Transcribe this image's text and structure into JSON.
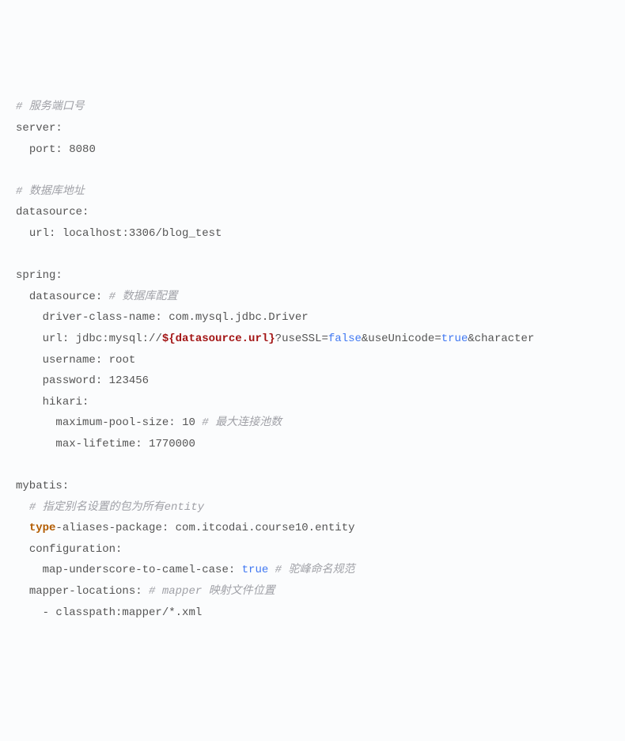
{
  "c_port": "# 服务端口号",
  "server": "server:",
  "port_k": "port:",
  "port_v": "8080",
  "c_db": "# 数据库地址",
  "ds": "datasource:",
  "ds_url_k": "url:",
  "ds_url_v": "localhost:3306/blog_test",
  "spring": "spring:",
  "spring_ds": "datasource:",
  "c_dbconf": "# 数据库配置",
  "driver_k": "driver-class-name:",
  "driver_v": "com.mysql.jdbc.Driver",
  "surl_k": "url:",
  "surl_pre": "jdbc:mysql://",
  "surl_ph": "${datasource.url}",
  "surl_q": "?useSSL=",
  "false": "false",
  "amp_uni": "&useUnicode=",
  "true": "true",
  "amp_tail": "&character",
  "user_k": "username:",
  "user_v": "root",
  "pass_k": "password:",
  "pass_v": "123456",
  "hikari": "hikari:",
  "pool_k": "maximum-pool-size:",
  "pool_v": "10",
  "c_pool": "# 最大连接池数",
  "life_k": "max-lifetime:",
  "life_v": "1770000",
  "mybatis": "mybatis:",
  "c_alias": "# 指定别名设置的包为所有entity",
  "type_kw": "type",
  "alias_rest": "-aliases-package:",
  "alias_v": "com.itcodai.course10.entity",
  "config": "configuration:",
  "camel_k": "map-underscore-to-camel-case:",
  "c_camel": "# 驼峰命名规范",
  "maploc_k": "mapper-locations:",
  "c_maploc": "# mapper 映射文件位置",
  "maploc_v": "- classpath:mapper/*.xml"
}
